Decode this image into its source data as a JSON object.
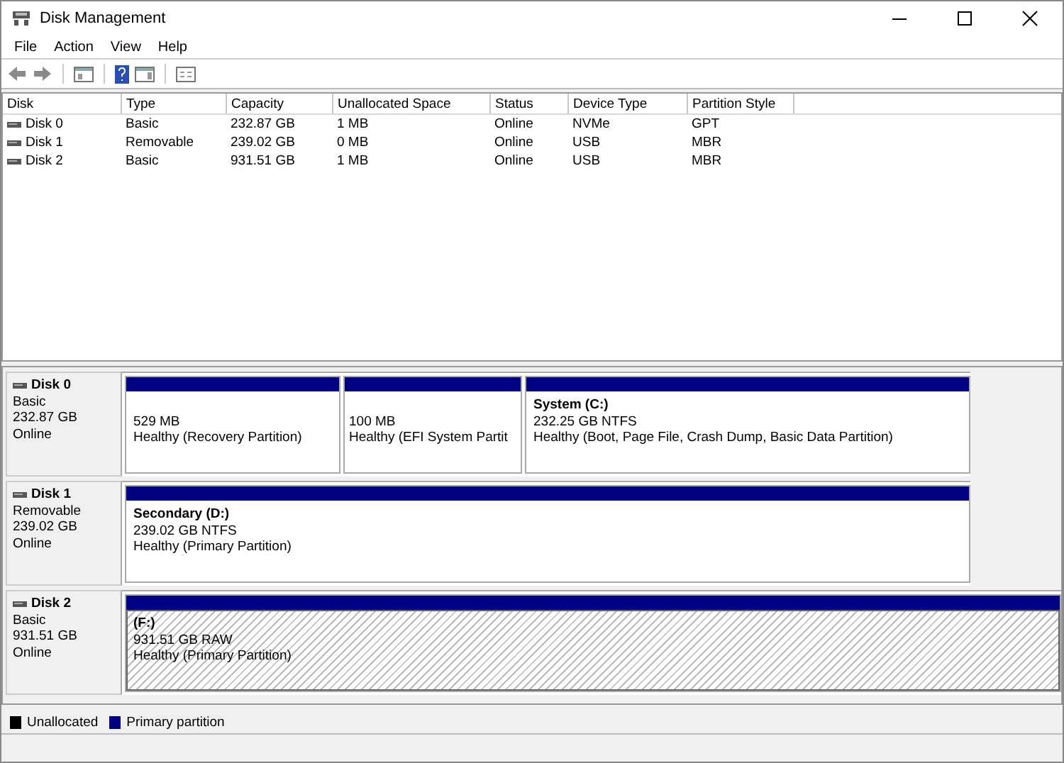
{
  "window": {
    "title": "Disk Management"
  },
  "menu": [
    "File",
    "Action",
    "View",
    "Help"
  ],
  "volume_list": {
    "columns": [
      "Disk",
      "Type",
      "Capacity",
      "Unallocated Space",
      "Status",
      "Device Type",
      "Partition Style"
    ],
    "rows": [
      {
        "cells": [
          "Disk 0",
          "Basic",
          "232.87 GB",
          "1 MB",
          "Online",
          "NVMe",
          "GPT"
        ]
      },
      {
        "cells": [
          "Disk 1",
          "Removable",
          "239.02 GB",
          "0 MB",
          "Online",
          "USB",
          "MBR"
        ]
      },
      {
        "cells": [
          "Disk 2",
          "Basic",
          "931.51 GB",
          "1 MB",
          "Online",
          "USB",
          "MBR"
        ]
      }
    ]
  },
  "disks": [
    {
      "name": "Disk 0",
      "type": "Basic",
      "size": "232.87 GB",
      "status": "Online",
      "partitions": [
        {
          "size": "529 MB",
          "health": "Healthy (Recovery Partition)",
          "selected": false
        },
        {
          "size": "100 MB",
          "health": "Healthy (EFI System Partit",
          "selected": false
        },
        {
          "title": "System  (C:)",
          "size": "232.25 GB NTFS",
          "health": "Healthy (Boot, Page File, Crash Dump, Basic Data Partition)",
          "selected": false
        }
      ]
    },
    {
      "name": "Disk 1",
      "type": "Removable",
      "size": "239.02 GB",
      "status": "Online",
      "partitions": [
        {
          "title": "Secondary  (D:)",
          "size": "239.02 GB NTFS",
          "health": "Healthy (Primary Partition)",
          "selected": false
        }
      ]
    },
    {
      "name": "Disk 2",
      "type": "Basic",
      "size": "931.51 GB",
      "status": "Online",
      "partitions": [
        {
          "title": "(F:)",
          "size": "931.51 GB RAW",
          "health": "Healthy (Primary Partition)",
          "selected": true
        }
      ]
    }
  ],
  "legend": [
    {
      "label": "Unallocated",
      "color": "#000000"
    },
    {
      "label": "Primary partition",
      "color": "#000080"
    }
  ]
}
